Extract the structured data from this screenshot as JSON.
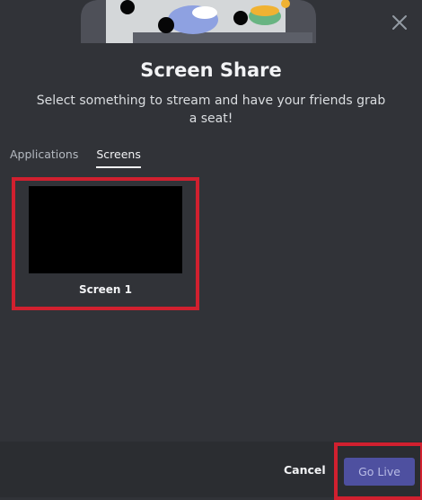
{
  "modal": {
    "title": "Screen Share",
    "subtitle": "Select something to stream and have your friends grab a seat!"
  },
  "tabs": [
    {
      "label": "Applications",
      "active": false
    },
    {
      "label": "Screens",
      "active": true
    }
  ],
  "screens": [
    {
      "label": "Screen 1"
    }
  ],
  "footer": {
    "cancel_label": "Cancel",
    "go_live_label": "Go Live"
  },
  "icons": {
    "close": "close-icon"
  },
  "colors": {
    "background": "#313338",
    "footer": "#2b2d31",
    "accent": "#5865f2",
    "highlight": "#d1202f"
  }
}
